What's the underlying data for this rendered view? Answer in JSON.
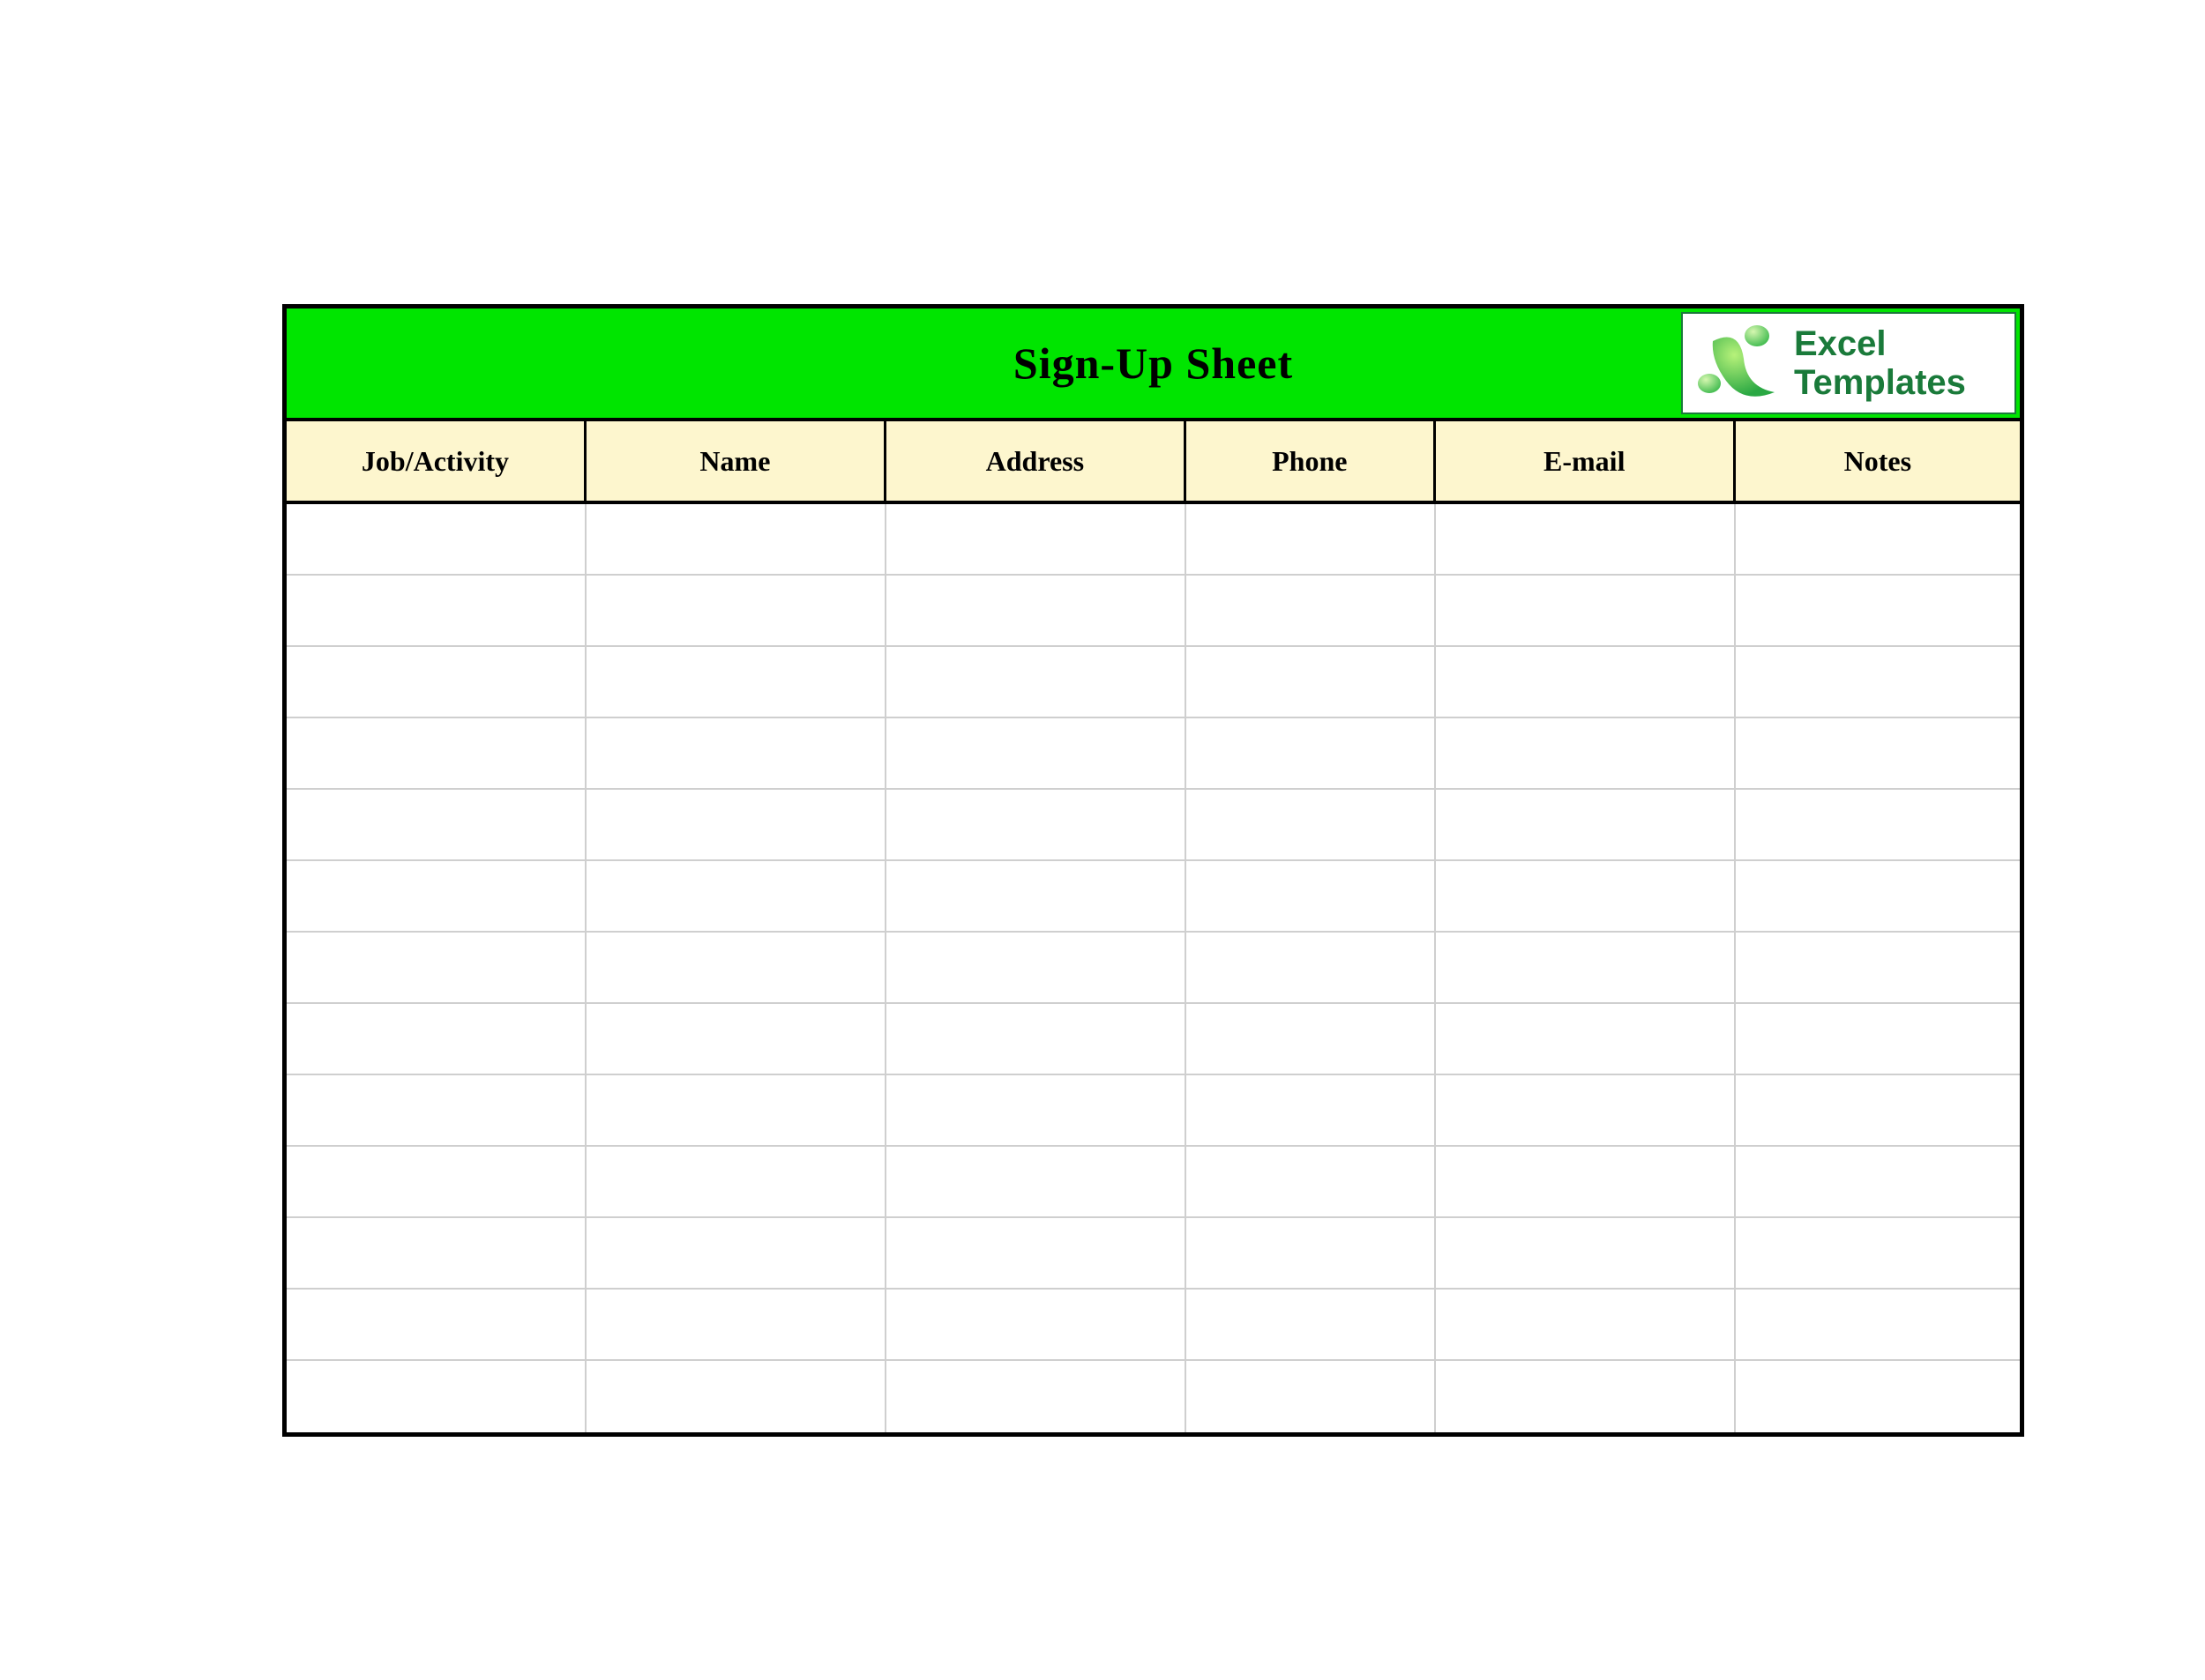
{
  "title": "Sign-Up Sheet",
  "logo": {
    "line1": "Excel",
    "line2": "Templates"
  },
  "columns": [
    "Job/Activity",
    "Name",
    "Address",
    "Phone",
    "E-mail",
    "Notes"
  ],
  "rows": [
    [
      "",
      "",
      "",
      "",
      "",
      ""
    ],
    [
      "",
      "",
      "",
      "",
      "",
      ""
    ],
    [
      "",
      "",
      "",
      "",
      "",
      ""
    ],
    [
      "",
      "",
      "",
      "",
      "",
      ""
    ],
    [
      "",
      "",
      "",
      "",
      "",
      ""
    ],
    [
      "",
      "",
      "",
      "",
      "",
      ""
    ],
    [
      "",
      "",
      "",
      "",
      "",
      ""
    ],
    [
      "",
      "",
      "",
      "",
      "",
      ""
    ],
    [
      "",
      "",
      "",
      "",
      "",
      ""
    ],
    [
      "",
      "",
      "",
      "",
      "",
      ""
    ],
    [
      "",
      "",
      "",
      "",
      "",
      ""
    ],
    [
      "",
      "",
      "",
      "",
      "",
      ""
    ],
    [
      "",
      "",
      "",
      "",
      "",
      ""
    ]
  ],
  "colors": {
    "header_bg": "#00e500",
    "col_bg": "#fdf6ce",
    "border": "#000000",
    "grid": "#cfcfcf",
    "logo_text": "#1a7a3a"
  }
}
